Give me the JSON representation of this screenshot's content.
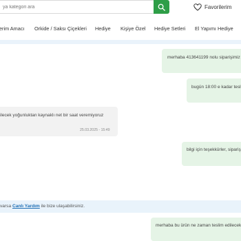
{
  "header": {
    "search_placeholder": "ya kategori ara",
    "favorites_label": "Favorilerim"
  },
  "nav": {
    "items": [
      "erim Amacı",
      "Orkide / Saksı Çiçekleri",
      "Hediye",
      "Kişiye Özel",
      "Hediye Setleri",
      "El Yapımı Hediye"
    ]
  },
  "chat": {
    "messages": [
      {
        "side": "out",
        "text": "merhaba 413641199 nolu siparişimiz"
      },
      {
        "side": "out",
        "text": "bugün 18:00 e kadar tesli"
      },
      {
        "side": "in",
        "text": "ilecek yoğunluktan kaynaklı net bir saat veremiyoruz",
        "time": "25.03.2025 - 15:49"
      },
      {
        "side": "out",
        "text": "bilgi için teşekkürler, siparişi"
      },
      {
        "side": "out",
        "text": "merhaba bu ürün ne zaman teslim edilecek b"
      }
    ]
  },
  "notice": {
    "prefix": "varsa ",
    "link": "Canlı Yardım",
    "suffix": " ile bize ulaşabilirsiniz."
  },
  "colors": {
    "accent": "#2e9e47",
    "out_bubble": "#e5f4e6",
    "in_bubble": "#f2f2f2",
    "notice_bg": "#e9f3fb",
    "link": "#1f6fb5"
  }
}
